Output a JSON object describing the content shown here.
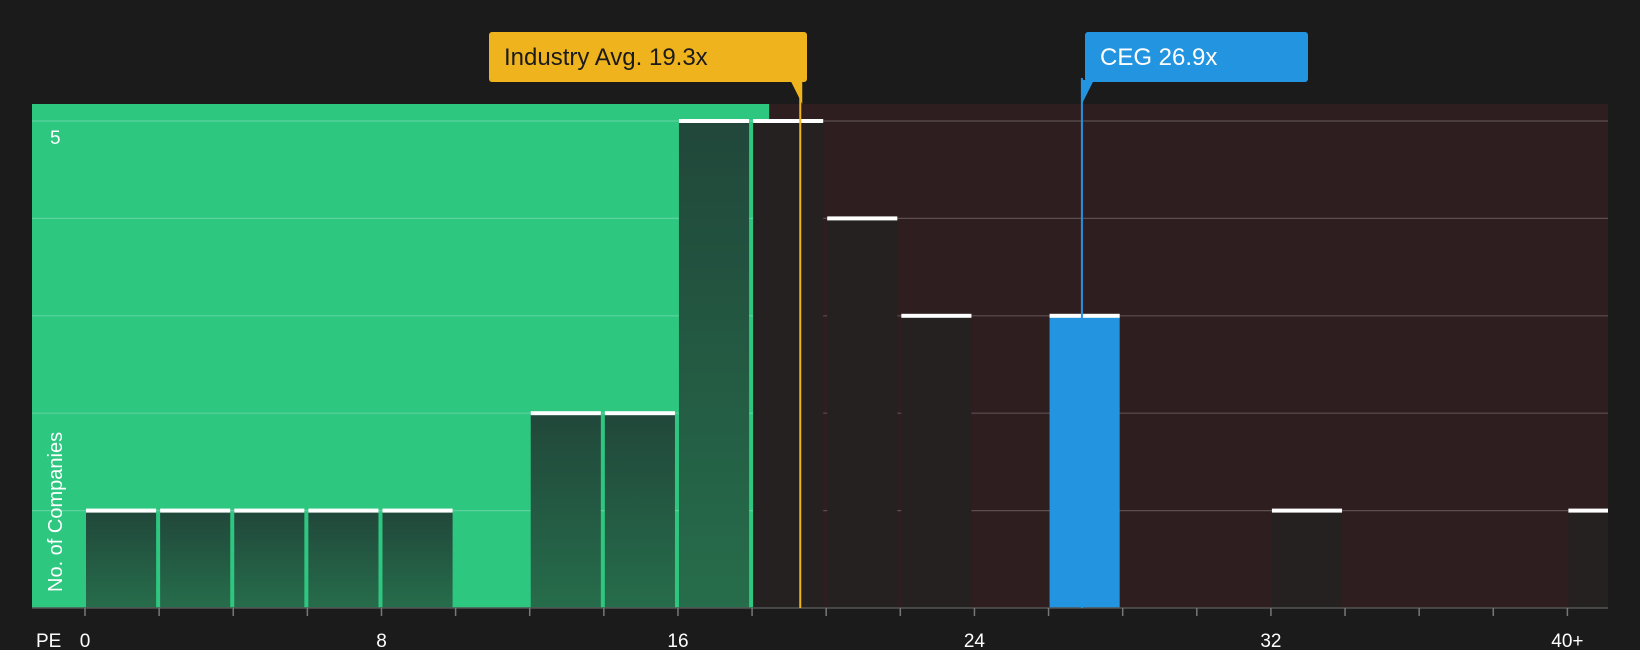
{
  "chart_data": {
    "type": "bar",
    "xlabel": "PE",
    "ylabel": "No. of Companies",
    "x_tick_labels": [
      "0",
      "8",
      "16",
      "24",
      "32",
      "40+"
    ],
    "x_ticks": [
      0,
      8,
      16,
      24,
      32,
      40
    ],
    "xlim": [
      -1.4,
      41
    ],
    "y_tick_labels": [
      "5"
    ],
    "ylim": [
      0,
      5
    ],
    "grid": true,
    "bin_width": 2,
    "bins": [
      {
        "start": 0,
        "count": 1
      },
      {
        "start": 2,
        "count": 1
      },
      {
        "start": 4,
        "count": 1
      },
      {
        "start": 6,
        "count": 1
      },
      {
        "start": 8,
        "count": 1
      },
      {
        "start": 12,
        "count": 2
      },
      {
        "start": 14,
        "count": 2
      },
      {
        "start": 16,
        "count": 5
      },
      {
        "start": 18,
        "count": 5
      },
      {
        "start": 20,
        "count": 4
      },
      {
        "start": 22,
        "count": 3
      },
      {
        "start": 26,
        "count": 3,
        "highlight": true
      },
      {
        "start": 32,
        "count": 1
      },
      {
        "start": 40,
        "count": 1
      }
    ],
    "annotations": [
      {
        "name": "industry-avg",
        "label": "Industry Avg. 19.3x",
        "value": 19.3,
        "color": "#efb31e"
      },
      {
        "name": "ceg",
        "label": "CEG 26.9x",
        "value": 26.9,
        "color": "#2394e0"
      }
    ],
    "colors": {
      "undervalued_region": "#2ec780",
      "overvalued_region": "#2f1e1f",
      "bar_dark": "#22493a",
      "bar_overvalued": "#252121",
      "bar_highlight": "#2394e0",
      "bar_top": "#ffffff"
    }
  }
}
